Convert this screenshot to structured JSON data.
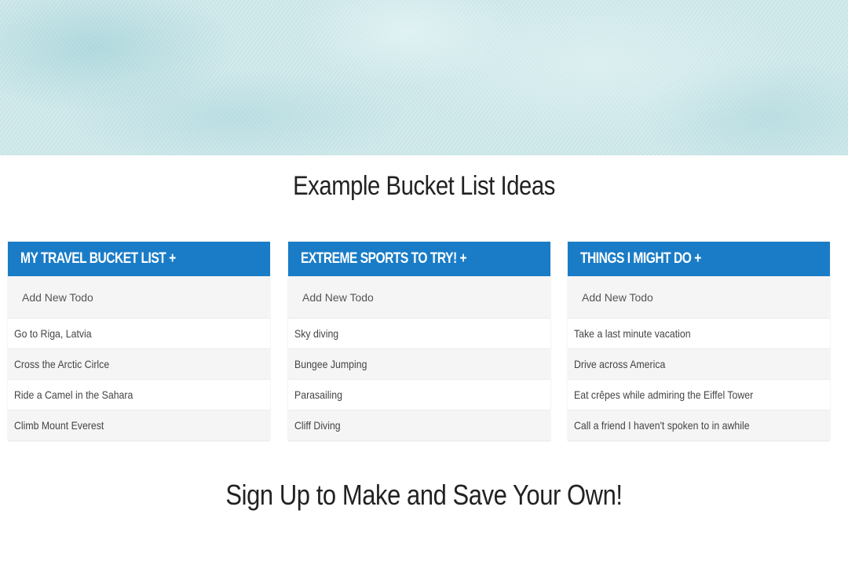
{
  "page": {
    "section_title": "Example Bucket List Ideas",
    "cta_title": "Sign Up to Make and Save Your Own!"
  },
  "colors": {
    "header_blue": "#1a7cc7",
    "row_alt": "#f5f5f5",
    "hero_teal": "#cfe8ea"
  },
  "lists": [
    {
      "title": "MY TRAVEL BUCKET LIST +",
      "input_placeholder": "Add New Todo",
      "items": [
        "Go to Riga, Latvia",
        "Cross the Arctic Cirlce",
        "Ride a Camel in the Sahara",
        "Climb Mount Everest"
      ]
    },
    {
      "title": "EXTREME SPORTS TO TRY! +",
      "input_placeholder": "Add New Todo",
      "items": [
        "Sky diving",
        "Bungee Jumping",
        "Parasailing",
        "Cliff Diving"
      ]
    },
    {
      "title": "THINGS I MIGHT DO +",
      "input_placeholder": "Add New Todo",
      "items": [
        "Take a last minute vacation",
        "Drive across America",
        "Eat crêpes while admiring the Eiffel Tower",
        "Call a friend I haven't spoken to in awhile"
      ]
    }
  ]
}
